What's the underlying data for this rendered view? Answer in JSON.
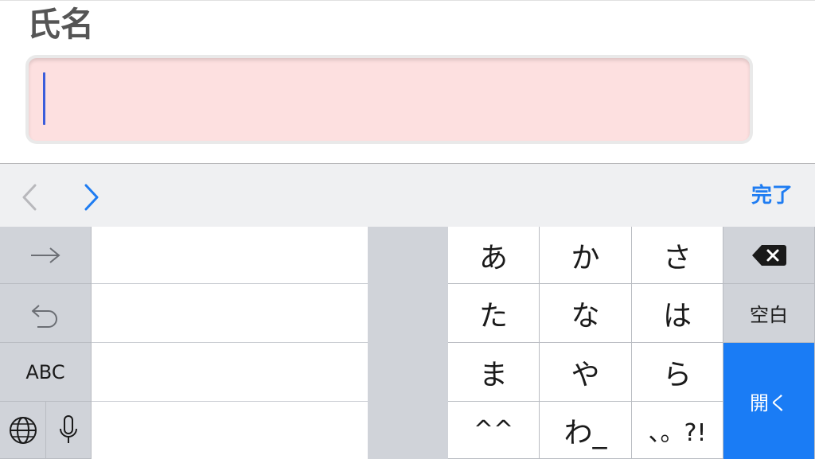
{
  "form": {
    "name_label": "氏名",
    "name_value": ""
  },
  "accessory_bar": {
    "done_label": "完了"
  },
  "keyboard": {
    "left_column": {
      "next_label": "→",
      "undo_label": "↺",
      "abc_label": "ABC"
    },
    "kana_rows": [
      [
        "あ",
        "か",
        "さ"
      ],
      [
        "た",
        "な",
        "は"
      ],
      [
        "ま",
        "や",
        "ら"
      ],
      [
        "^^",
        "わ_",
        "、。?!"
      ]
    ],
    "right_column": {
      "space_label": "空白",
      "enter_label": "開く"
    }
  },
  "colors": {
    "accent": "#1e7cf2",
    "input_background": "#fde0e0",
    "keyboard_gray": "#d0d3d9",
    "enter_blue": "#1a7cf5"
  },
  "icons": [
    "chevron-left-icon",
    "chevron-right-icon",
    "arrow-right-icon",
    "undo-icon",
    "globe-icon",
    "microphone-icon",
    "backspace-icon"
  ]
}
